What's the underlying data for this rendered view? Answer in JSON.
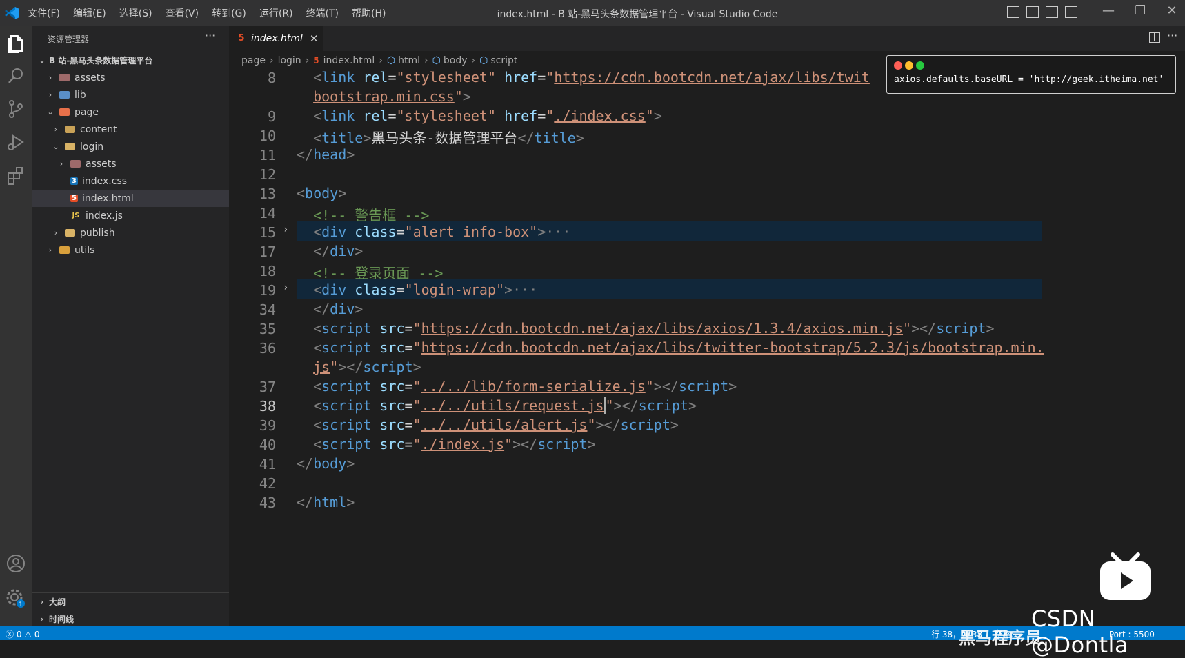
{
  "titlebar": {
    "menu": [
      "文件(F)",
      "编辑(E)",
      "选择(S)",
      "查看(V)",
      "转到(G)",
      "运行(R)",
      "终端(T)",
      "帮助(H)"
    ],
    "window_title": "index.html - B 站-黑马头条数据管理平台 - Visual Studio Code",
    "window_controls": [
      "—",
      "❐",
      "✕"
    ]
  },
  "explorer": {
    "header": "资源管理器",
    "more": "···",
    "workspace": "B 站-黑马头条数据管理平台",
    "items": [
      {
        "label": "assets"
      },
      {
        "label": "lib"
      },
      {
        "label": "page"
      },
      {
        "label": "content"
      },
      {
        "label": "login"
      },
      {
        "label": "assets"
      },
      {
        "label": "index.css"
      },
      {
        "label": "index.html"
      },
      {
        "label": "index.js"
      },
      {
        "label": "publish"
      },
      {
        "label": "utils"
      }
    ],
    "outline": "大纲",
    "timeline": "时间线"
  },
  "tab": {
    "label": "index.html",
    "close": "✕",
    "more": "···"
  },
  "breadcrumb": [
    "page",
    "login",
    "index.html",
    "html",
    "body",
    "script"
  ],
  "code_lines": [
    {
      "num": "8",
      "text": [
        "<link rel=\"stylesheet\" href=\"",
        "https://cdn.bootcdn.net/ajax/libs/twit",
        "\">"
      ]
    },
    {
      "num": "",
      "text": [
        "bootstrap.min.css",
        "\">"
      ]
    },
    {
      "num": "9",
      "text": [
        "<link rel=\"stylesheet\" href=\"",
        "./index.css",
        "\">"
      ]
    },
    {
      "num": "10",
      "text": [
        "<title>",
        "黑马头条-数据管理平台",
        "</title>"
      ]
    },
    {
      "num": "11",
      "text": [
        "</head>"
      ]
    },
    {
      "num": "12",
      "text": [
        ""
      ]
    },
    {
      "num": "13",
      "text": [
        "<body>"
      ]
    },
    {
      "num": "14",
      "text": [
        "<!-- 警告框 -->"
      ]
    },
    {
      "num": "15",
      "text": [
        "<div class=\"alert info-box\">",
        "···"
      ]
    },
    {
      "num": "17",
      "text": [
        "</div>"
      ]
    },
    {
      "num": "18",
      "text": [
        "<!-- 登录页面 -->"
      ]
    },
    {
      "num": "19",
      "text": [
        "<div class=\"login-wrap\">",
        "···"
      ]
    },
    {
      "num": "34",
      "text": [
        "</div>"
      ]
    },
    {
      "num": "35",
      "text": [
        "https://cdn.bootcdn.net/ajax/libs/axios/1.3.4/axios.min.js"
      ]
    },
    {
      "num": "36",
      "text": [
        "https://cdn.bootcdn.net/ajax/libs/twitter-bootstrap/5.2.3/js/bootstrap.min."
      ]
    },
    {
      "num": "",
      "text": [
        "js"
      ]
    },
    {
      "num": "37",
      "text": [
        "../../lib/form-serialize.js"
      ]
    },
    {
      "num": "38",
      "text": [
        "../../utils/request.js"
      ]
    },
    {
      "num": "39",
      "text": [
        "../../utils/alert.js"
      ]
    },
    {
      "num": "40",
      "text": [
        "./index.js"
      ]
    },
    {
      "num": "41",
      "text": [
        "</body>"
      ]
    },
    {
      "num": "42",
      "text": [
        ""
      ]
    },
    {
      "num": "43",
      "text": [
        "</html>"
      ]
    }
  ],
  "popup": {
    "code": "axios.defaults.baseURL = 'http://geek.itheima.net'",
    "dot_colors": [
      "#ff5f56",
      "#ffbd2e",
      "#27c93f"
    ]
  },
  "statusbar": {
    "problems": "ⓧ 0 ⚠ 0",
    "position": "行 38，列 38",
    "spaces": "空格:",
    "port": "Port : 5500"
  },
  "overlay": {
    "watermark": "CSDN @Dontla",
    "channel": "黑马程序员"
  },
  "colors": {
    "accent": "#007acc",
    "tag": "#569cd6",
    "attr": "#9cdcfe",
    "string": "#ce9178",
    "comment": "#6a9955"
  }
}
